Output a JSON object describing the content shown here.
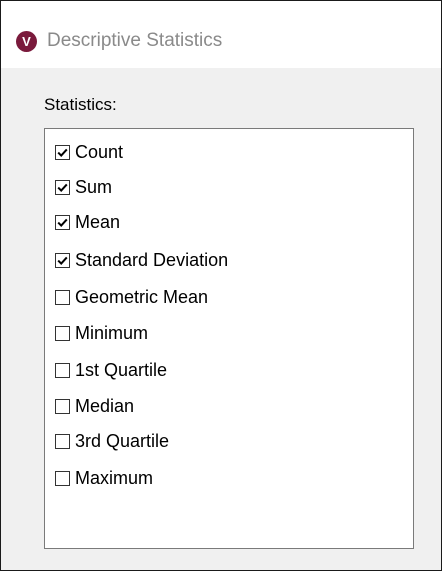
{
  "window": {
    "title": "Descriptive Statistics",
    "app_icon_letter": "V",
    "app_icon_color": "#7a1a3c"
  },
  "statistics": {
    "label": "Statistics:",
    "items": [
      {
        "label": "Count",
        "checked": true
      },
      {
        "label": "Sum",
        "checked": true
      },
      {
        "label": "Mean",
        "checked": true
      },
      {
        "label": "Standard Deviation",
        "checked": true
      },
      {
        "label": "Geometric Mean",
        "checked": false
      },
      {
        "label": "Minimum",
        "checked": false
      },
      {
        "label": "1st Quartile",
        "checked": false
      },
      {
        "label": "Median",
        "checked": false
      },
      {
        "label": "3rd Quartile",
        "checked": false
      },
      {
        "label": "Maximum",
        "checked": false
      }
    ]
  }
}
